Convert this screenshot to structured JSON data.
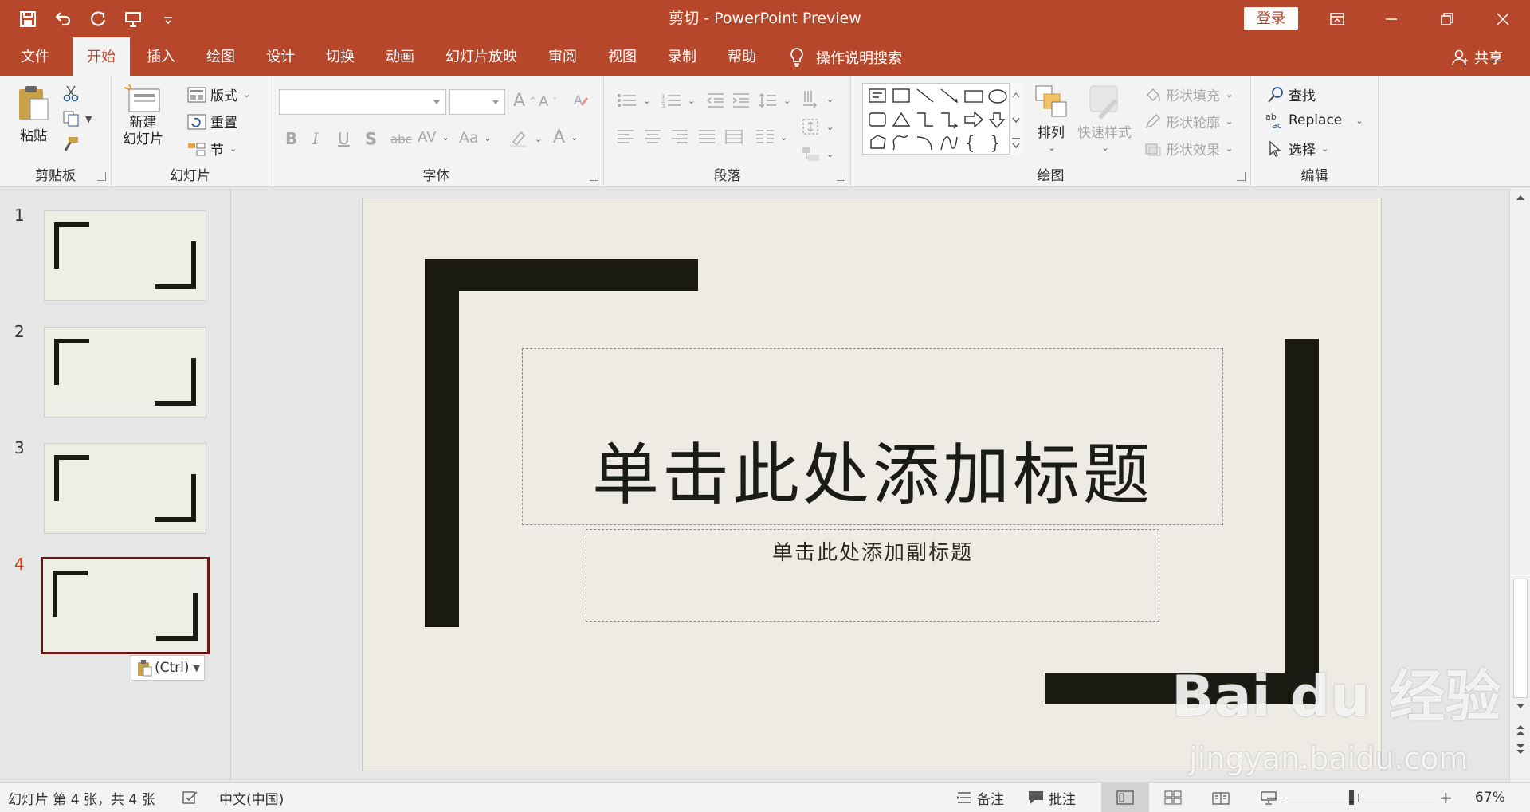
{
  "window": {
    "title": "剪切  -  PowerPoint Preview",
    "login_label": "登录"
  },
  "tabs": [
    "文件",
    "开始",
    "插入",
    "绘图",
    "设计",
    "切换",
    "动画",
    "幻灯片放映",
    "审阅",
    "视图",
    "录制",
    "帮助"
  ],
  "active_tab": "开始",
  "tell_me": "操作说明搜索",
  "share_label": "共享",
  "ribbon": {
    "clipboard": {
      "label": "剪贴板",
      "paste": "粘贴"
    },
    "slides": {
      "label": "幻灯片",
      "new_slide_line1": "新建",
      "new_slide_line2": "幻灯片",
      "layout": "版式",
      "reset": "重置",
      "section": "节"
    },
    "font": {
      "label": "字体",
      "bold": "B",
      "italic": "I",
      "underline": "U",
      "strike": "S",
      "abc": "abc",
      "av": "AV",
      "aa": "Aa",
      "grow": "A",
      "shrink": "A",
      "color_a": "A"
    },
    "paragraph": {
      "label": "段落"
    },
    "drawing": {
      "label": "绘图",
      "arrange": "排列",
      "quick_styles": "快速样式",
      "fill": "形状填充",
      "outline": "形状轮廓",
      "effects": "形状效果"
    },
    "editing": {
      "label": "编辑",
      "find": "查找",
      "replace": "Replace",
      "select": "选择"
    }
  },
  "slides": [
    {
      "num": "1"
    },
    {
      "num": "2"
    },
    {
      "num": "3"
    },
    {
      "num": "4"
    }
  ],
  "current_slide": "4",
  "paste_options": "(Ctrl)",
  "slide": {
    "title": "单击此处添加标题",
    "subtitle": "单击此处添加副标题"
  },
  "status": {
    "slide_info": "幻灯片 第 4 张，共 4 张",
    "language": "中文(中国)",
    "notes": "备注",
    "comments": "批注",
    "zoom": "67%",
    "minus": "−",
    "plus": "+"
  },
  "watermark": {
    "main": "Bai du 经验",
    "sub": "jingyan.baidu.com"
  },
  "colors": {
    "accent": "#b7472a",
    "slide_bg": "#edebe3",
    "frame": "#1a1a12",
    "current_thumb_border": "#6b1515"
  }
}
